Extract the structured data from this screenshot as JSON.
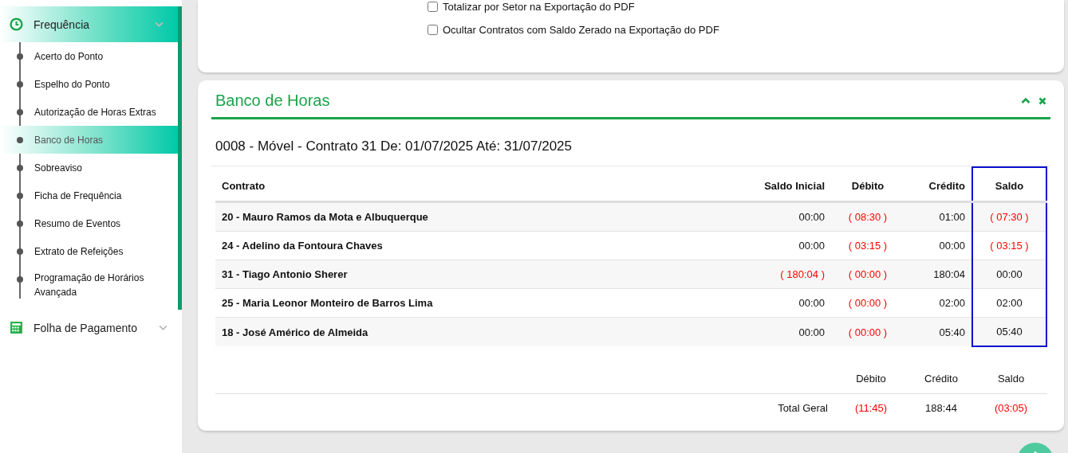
{
  "sidebar": {
    "menus": [
      {
        "label": "Frequência",
        "expanded": true,
        "children": [
          {
            "label": "Acerto do Ponto",
            "selected": false
          },
          {
            "label": "Espelho do Ponto",
            "selected": false
          },
          {
            "label": "Autorização de Horas Extras",
            "selected": false
          },
          {
            "label": "Banco de Horas",
            "selected": true
          },
          {
            "label": "Sobreaviso",
            "selected": false
          },
          {
            "label": "Ficha de Frequência",
            "selected": false
          },
          {
            "label": "Resumo de Eventos",
            "selected": false
          },
          {
            "label": "Extrato de Refeições",
            "selected": false
          },
          {
            "label": "Programação de Horários Avançada",
            "selected": false
          }
        ]
      },
      {
        "label": "Folha de Pagamento",
        "expanded": false
      }
    ]
  },
  "options": [
    {
      "label": "Totalizar por Setor na Exportação do PDF",
      "checked": false
    },
    {
      "label": "Ocultar Contratos com Saldo Zerado na Exportação do PDF",
      "checked": false
    }
  ],
  "panel": {
    "title": "Banco de Horas",
    "subtitle": "0008 - Móvel - Contrato 31 De: 01/07/2025 Até: 31/07/2025",
    "table": {
      "columns": [
        {
          "label": "Contrato",
          "highlighted": false
        },
        {
          "label": "Saldo Inicial",
          "highlighted": false
        },
        {
          "label": "Débito",
          "highlighted": false
        },
        {
          "label": "Crédito",
          "highlighted": false
        },
        {
          "label": "Saldo",
          "highlighted": true
        }
      ],
      "rows": [
        [
          {
            "value": "20 - Mauro Ramos da Mota e Albuquerque",
            "negative": false
          },
          {
            "value": "00:00",
            "negative": false
          },
          {
            "value": "( 08:30 )",
            "negative": true
          },
          {
            "value": "01:00",
            "negative": false
          },
          {
            "value": "( 07:30 )",
            "negative": true
          }
        ],
        [
          {
            "value": "24 - Adelino da Fontoura Chaves",
            "negative": false
          },
          {
            "value": "00:00",
            "negative": false
          },
          {
            "value": "( 03:15 )",
            "negative": true
          },
          {
            "value": "00:00",
            "negative": false
          },
          {
            "value": "( 03:15 )",
            "negative": true
          }
        ],
        [
          {
            "value": "31 - Tiago Antonio Sherer",
            "negative": false
          },
          {
            "value": "( 180:04 )",
            "negative": true
          },
          {
            "value": "( 00:00 )",
            "negative": true
          },
          {
            "value": "180:04",
            "negative": false
          },
          {
            "value": "00:00",
            "negative": false
          }
        ],
        [
          {
            "value": "25 - Maria Leonor Monteiro de Barros Lima",
            "negative": false
          },
          {
            "value": "00:00",
            "negative": false
          },
          {
            "value": "( 00:00 )",
            "negative": true
          },
          {
            "value": "02:00",
            "negative": false
          },
          {
            "value": "02:00",
            "negative": false
          }
        ],
        [
          {
            "value": "18 - José Américo de Almeida",
            "negative": false
          },
          {
            "value": "00:00",
            "negative": false
          },
          {
            "value": "( 00:00 )",
            "negative": true
          },
          {
            "value": "05:40",
            "negative": false
          },
          {
            "value": "05:40",
            "negative": false
          }
        ]
      ]
    },
    "totals": {
      "columns": [
        "Débito",
        "Crédito",
        "Saldo"
      ],
      "label": "Total Geral",
      "values": [
        {
          "value": "(11:45)",
          "negative": true
        },
        {
          "value": "188:44",
          "negative": false
        },
        {
          "value": "(03:05)",
          "negative": true
        }
      ]
    }
  }
}
